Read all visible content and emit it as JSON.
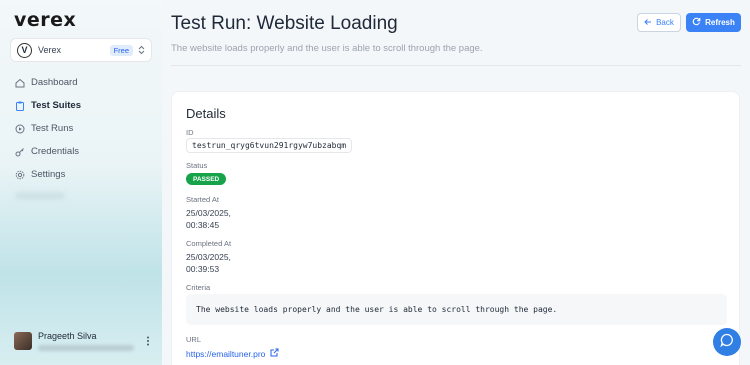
{
  "app": {
    "logo": "verex"
  },
  "org": {
    "avatar_letter": "V",
    "name": "Verex",
    "plan": "Free"
  },
  "nav": [
    {
      "label": "Dashboard",
      "icon": "home-icon"
    },
    {
      "label": "Test Suites",
      "icon": "clipboard-icon",
      "active": true
    },
    {
      "label": "Test Runs",
      "icon": "play-circle-icon"
    },
    {
      "label": "Credentials",
      "icon": "key-icon"
    },
    {
      "label": "Settings",
      "icon": "gear-icon"
    }
  ],
  "user": {
    "name": "Prageeth Silva"
  },
  "header": {
    "title": "Test Run: Website Loading",
    "subtitle": "The website loads properly and the user is able to scroll through the page.",
    "back_label": "Back",
    "refresh_label": "Refresh"
  },
  "details": {
    "title": "Details",
    "id_label": "ID",
    "id_value": "testrun_qryg6tvun291rgyw7ubzabqm",
    "status_label": "Status",
    "status_value": "PASSED",
    "started_label": "Started At",
    "started_date": "25/03/2025,",
    "started_time": "00:38:45",
    "completed_label": "Completed At",
    "completed_date": "25/03/2025,",
    "completed_time": "00:39:53",
    "criteria_label": "Criteria",
    "criteria_value": "The website loads properly and the user is able to scroll through the page.",
    "url_label": "URL",
    "url_value": "https://emailtuner.pro"
  },
  "colors": {
    "accent": "#3b82f6",
    "status_passed": "#16a34a"
  }
}
